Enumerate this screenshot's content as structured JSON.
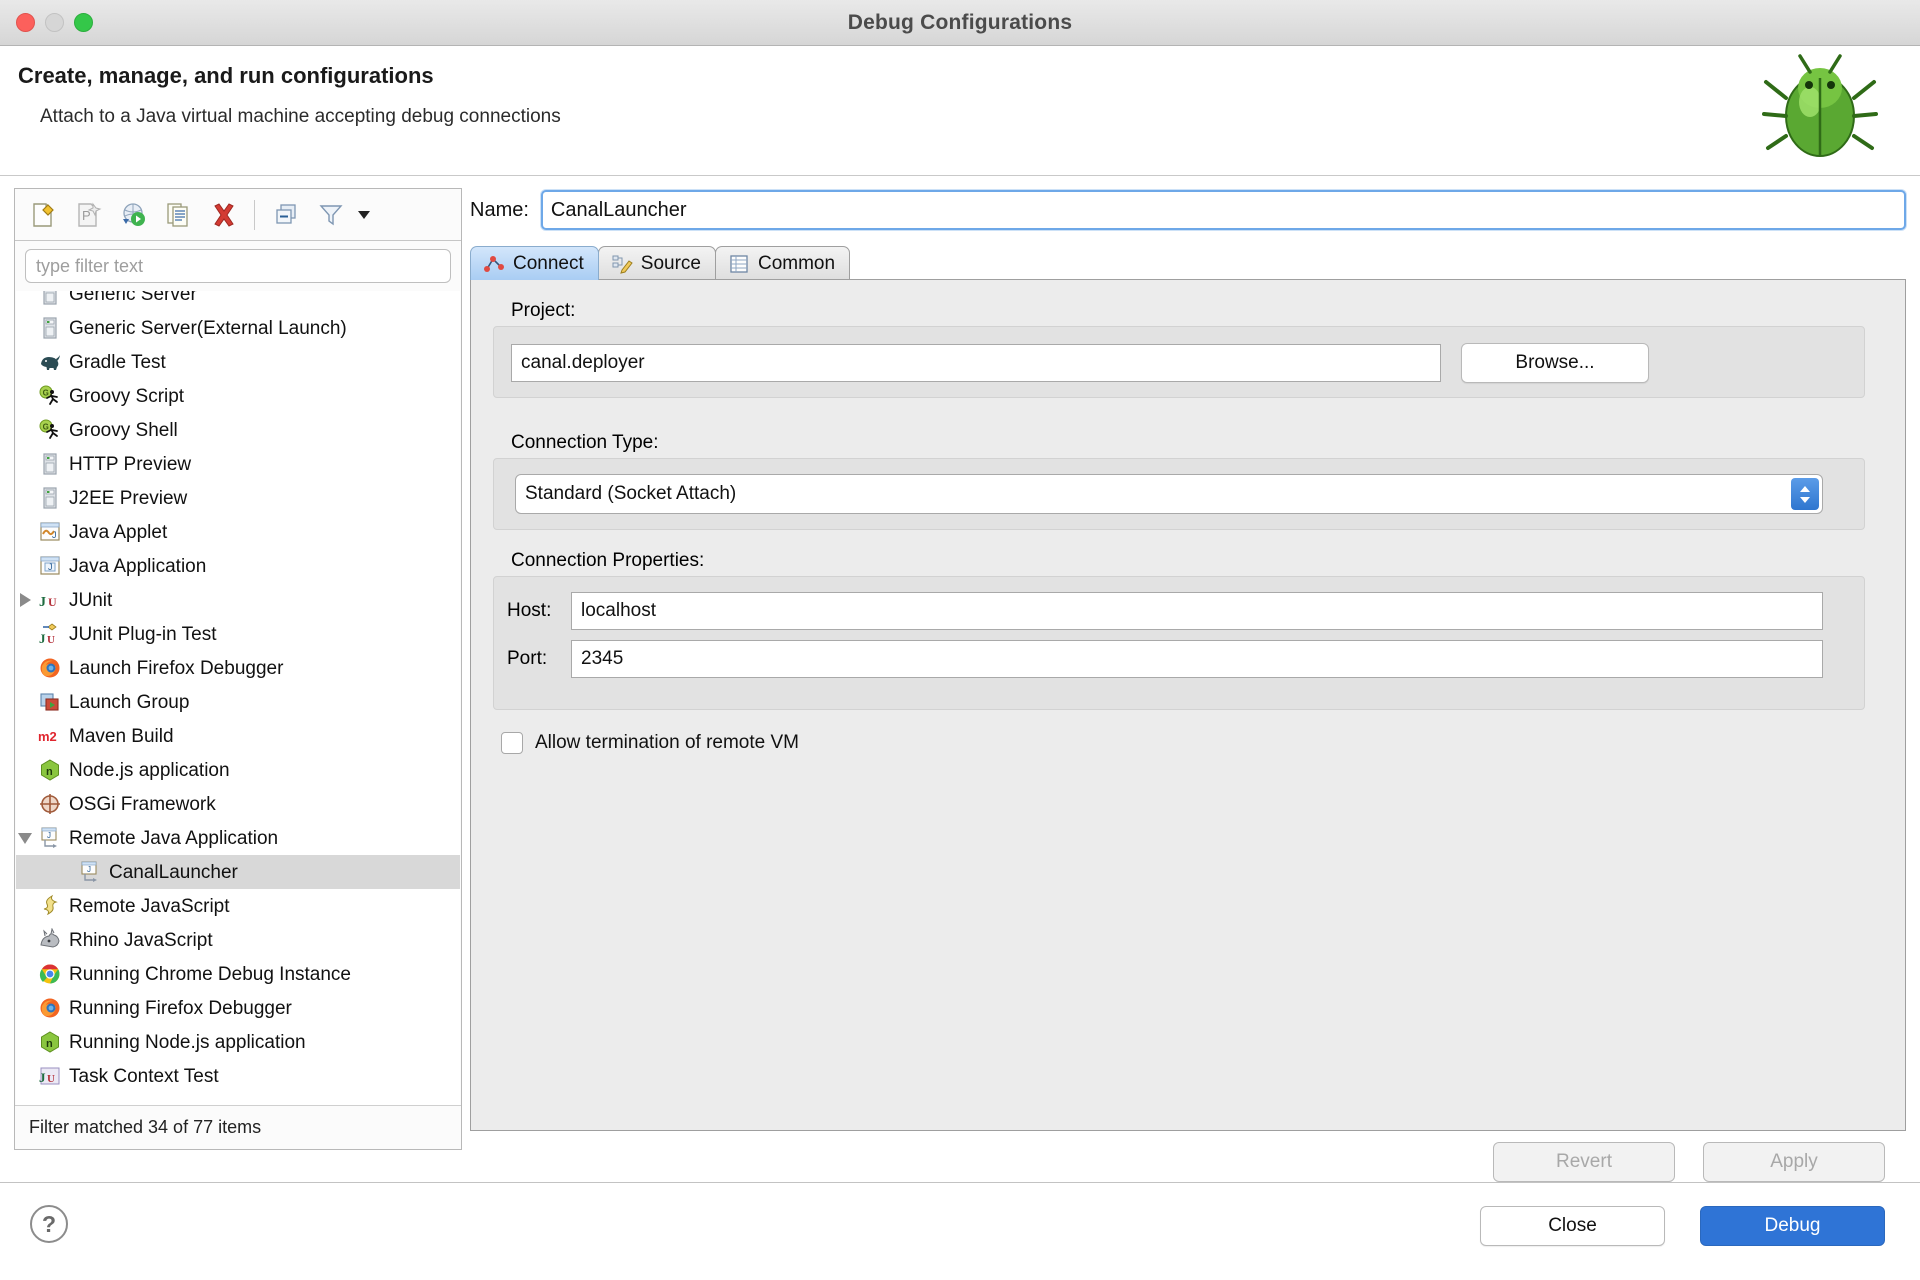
{
  "window": {
    "title": "Debug Configurations",
    "traffic_lights": [
      "close-red",
      "minimize-gray",
      "maximize-green"
    ]
  },
  "header": {
    "title": "Create, manage, and run configurations",
    "subtitle": "Attach to a Java virtual machine accepting debug connections",
    "decoration_icon": "bug-icon"
  },
  "sidebar": {
    "toolbar": [
      {
        "name": "new-configuration-icon",
        "tooltip": "New launch configuration"
      },
      {
        "name": "new-prototype-icon",
        "tooltip": "New prototype"
      },
      {
        "name": "export-configuration-icon",
        "tooltip": "Export"
      },
      {
        "name": "duplicate-configuration-icon",
        "tooltip": "Duplicate"
      },
      {
        "name": "delete-configuration-icon",
        "tooltip": "Delete"
      },
      {
        "name": "collapse-all-icon",
        "tooltip": "Collapse All"
      },
      {
        "name": "filter-icon",
        "tooltip": "Filter"
      },
      {
        "name": "chevron-down-icon",
        "tooltip": "Filter menu"
      }
    ],
    "filter": {
      "placeholder": "type filter text",
      "value": ""
    },
    "status": "Filter matched 34 of 77 items",
    "tree": [
      {
        "label": "Generic Server",
        "icon": "server-icon",
        "depth": 0,
        "twisty": "none",
        "selected": false
      },
      {
        "label": "Generic Server(External Launch)",
        "icon": "server-icon",
        "depth": 0,
        "twisty": "none",
        "selected": false
      },
      {
        "label": "Gradle Test",
        "icon": "gradle-elephant-icon",
        "depth": 0,
        "twisty": "none",
        "selected": false
      },
      {
        "label": "Groovy Script",
        "icon": "groovy-runner-icon",
        "depth": 0,
        "twisty": "none",
        "selected": false
      },
      {
        "label": "Groovy Shell",
        "icon": "groovy-runner-icon",
        "depth": 0,
        "twisty": "none",
        "selected": false
      },
      {
        "label": "HTTP Preview",
        "icon": "server-icon",
        "depth": 0,
        "twisty": "none",
        "selected": false
      },
      {
        "label": "J2EE Preview",
        "icon": "server-icon",
        "depth": 0,
        "twisty": "none",
        "selected": false
      },
      {
        "label": "Java Applet",
        "icon": "java-applet-icon",
        "depth": 0,
        "twisty": "none",
        "selected": false
      },
      {
        "label": "Java Application",
        "icon": "java-application-icon",
        "depth": 0,
        "twisty": "none",
        "selected": false
      },
      {
        "label": "JUnit",
        "icon": "junit-icon",
        "depth": 0,
        "twisty": "collapsed",
        "selected": false
      },
      {
        "label": "JUnit Plug-in Test",
        "icon": "junit-plugin-icon",
        "depth": 0,
        "twisty": "none",
        "selected": false
      },
      {
        "label": "Launch Firefox Debugger",
        "icon": "firefox-icon",
        "depth": 0,
        "twisty": "none",
        "selected": false
      },
      {
        "label": "Launch Group",
        "icon": "launch-group-icon",
        "depth": 0,
        "twisty": "none",
        "selected": false
      },
      {
        "label": "Maven Build",
        "icon": "maven-m2-icon",
        "depth": 0,
        "twisty": "none",
        "selected": false
      },
      {
        "label": "Node.js application",
        "icon": "nodejs-icon",
        "depth": 0,
        "twisty": "none",
        "selected": false
      },
      {
        "label": "OSGi Framework",
        "icon": "osgi-icon",
        "depth": 0,
        "twisty": "none",
        "selected": false
      },
      {
        "label": "Remote Java Application",
        "icon": "remote-java-icon",
        "depth": 0,
        "twisty": "expanded",
        "selected": false
      },
      {
        "label": "CanalLauncher",
        "icon": "remote-java-icon",
        "depth": 1,
        "twisty": "none",
        "selected": true
      },
      {
        "label": "Remote JavaScript",
        "icon": "remote-javascript-icon",
        "depth": 0,
        "twisty": "none",
        "selected": false
      },
      {
        "label": "Rhino JavaScript",
        "icon": "rhino-icon",
        "depth": 0,
        "twisty": "none",
        "selected": false
      },
      {
        "label": "Running Chrome Debug Instance",
        "icon": "chrome-icon",
        "depth": 0,
        "twisty": "none",
        "selected": false
      },
      {
        "label": "Running Firefox Debugger",
        "icon": "firefox-icon",
        "depth": 0,
        "twisty": "none",
        "selected": false
      },
      {
        "label": "Running Node.js application",
        "icon": "nodejs-icon",
        "depth": 0,
        "twisty": "none",
        "selected": false
      },
      {
        "label": "Task Context Test",
        "icon": "task-context-icon",
        "depth": 0,
        "twisty": "none",
        "selected": false
      }
    ]
  },
  "editor": {
    "name_label": "Name:",
    "name_value": "CanalLauncher",
    "tabs": [
      {
        "label": "Connect",
        "icon": "connect-icon",
        "active": true
      },
      {
        "label": "Source",
        "icon": "source-pencil-icon",
        "active": false
      },
      {
        "label": "Common",
        "icon": "common-table-icon",
        "active": false
      }
    ],
    "project": {
      "label": "Project:",
      "value": "canal.deployer",
      "browse_label": "Browse..."
    },
    "connection_type": {
      "label": "Connection Type:",
      "selected": "Standard (Socket Attach)"
    },
    "connection_properties": {
      "label": "Connection Properties:",
      "host_label": "Host:",
      "host_value": "localhost",
      "port_label": "Port:",
      "port_value": "2345"
    },
    "allow_termination": {
      "label": "Allow termination of remote VM",
      "checked": false
    },
    "revert_label": "Revert",
    "apply_label": "Apply"
  },
  "footer": {
    "help_label": "?",
    "close_label": "Close",
    "debug_label": "Debug"
  },
  "colors": {
    "accent": "#2f74d6",
    "tab_active": "#a9cdf3",
    "selection": "#d8d8d8",
    "panel_bg": "#ececec"
  }
}
